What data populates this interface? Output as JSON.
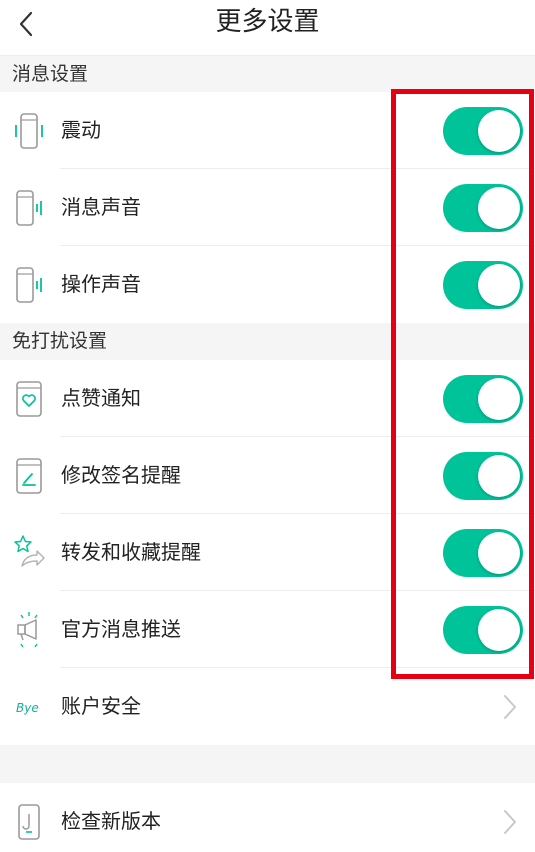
{
  "header": {
    "title": "更多设置"
  },
  "sections": {
    "message": {
      "title": "消息设置",
      "vibrate": "震动",
      "msg_sound": "消息声音",
      "op_sound": "操作声音"
    },
    "dnd": {
      "title": "免打扰设置",
      "like_notify": "点赞通知",
      "sign_remind": "修改签名提醒",
      "forward_remind": "转发和收藏提醒",
      "official_push": "官方消息推送"
    },
    "account": {
      "security": "账户安全",
      "security_icon_text": "Bye"
    },
    "update": {
      "check_version": "检查新版本"
    }
  },
  "toggles": {
    "vibrate": true,
    "msg_sound": true,
    "op_sound": true,
    "like_notify": true,
    "sign_remind": true,
    "forward_remind": true,
    "official_push": true
  },
  "colors": {
    "accent": "#00c39a",
    "highlight": "#e60012",
    "section_bg": "#f5f5f5"
  }
}
